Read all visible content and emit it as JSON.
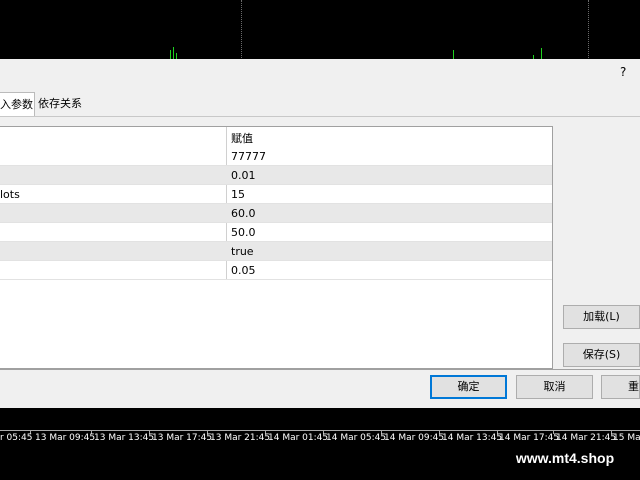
{
  "dialog": {
    "help_label": "?",
    "tabs": [
      {
        "label": "入参数"
      },
      {
        "label": "依存关系"
      }
    ],
    "table": {
      "value_header": "赋值",
      "rows": [
        {
          "name": "",
          "value": "77777"
        },
        {
          "name": "",
          "value": "0.01"
        },
        {
          "name": "lots",
          "value": "15"
        },
        {
          "name": "",
          "value": "60.0"
        },
        {
          "name": "",
          "value": "50.0"
        },
        {
          "name": "",
          "value": "true"
        },
        {
          "name": "",
          "value": "0.05"
        }
      ]
    },
    "buttons": {
      "load": "加载(L)",
      "save": "保存(S)",
      "ok": "确定",
      "cancel": "取消",
      "reset": "重"
    }
  },
  "chart": {
    "time_labels": [
      "r 05:45",
      "13 Mar 09:45",
      "13 Mar 13:45",
      "13 Mar 17:45",
      "13 Mar 21:45",
      "14 Mar 01:45",
      "14 Mar 05:45",
      "14 Mar 09:45",
      "14 Mar 13:45",
      "14 Mar 17:45",
      "14 Mar 21:45",
      "15 Ma"
    ],
    "bar_color": "#1fd11f"
  },
  "watermark": "www.mt4.shop"
}
